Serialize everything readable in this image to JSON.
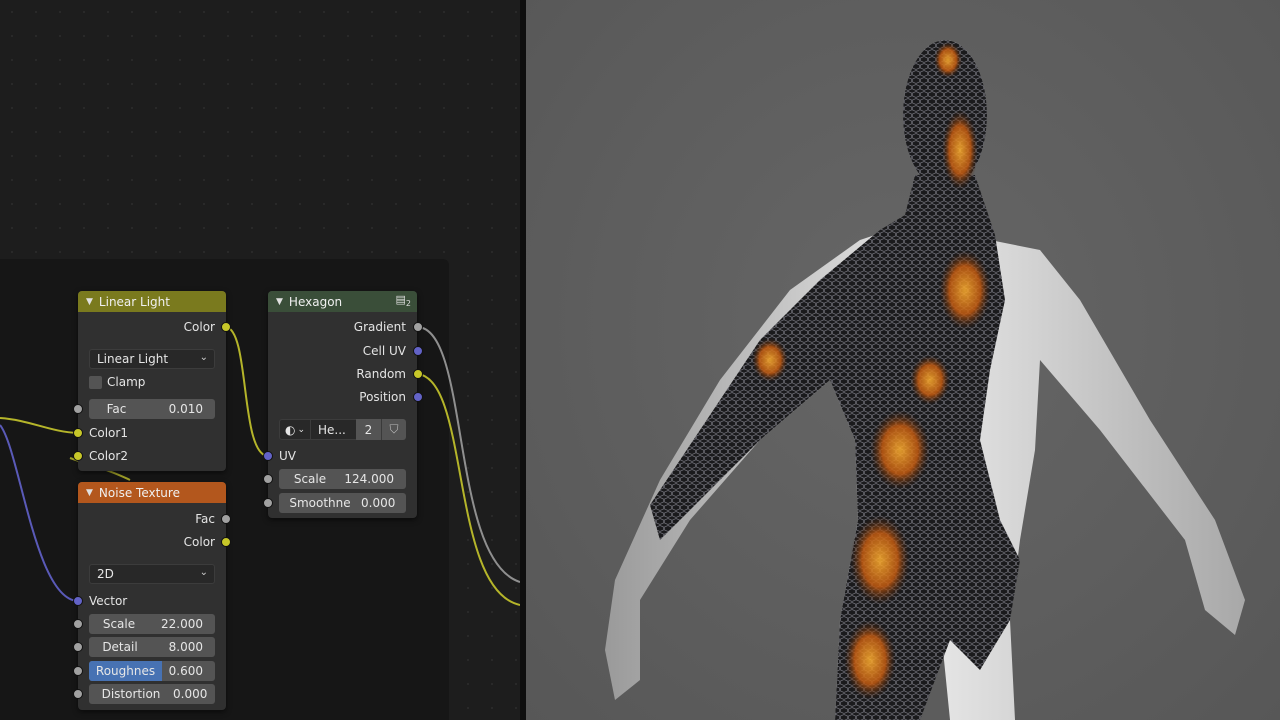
{
  "colors": {
    "wire_yellow": "#c7c729",
    "wire_grey": "#a1a1a1",
    "wire_blue": "#6363c7",
    "linear_light_header": "#7a7a1e",
    "noise_header": "#b3571d",
    "hexagon_header": "#3a4e39",
    "active_field": "#4772b3"
  },
  "linear_light": {
    "title": "Linear Light",
    "output_color": "Color",
    "blend_mode": "Linear Light",
    "clamp_label": "Clamp",
    "fac_label": "Fac",
    "fac_value": "0.010",
    "color1": "Color1",
    "color2": "Color2"
  },
  "noise_texture": {
    "title": "Noise Texture",
    "output_fac": "Fac",
    "output_color": "Color",
    "dimensions": "2D",
    "vector_label": "Vector",
    "scale_label": "Scale",
    "scale_value": "22.000",
    "detail_label": "Detail",
    "detail_value": "8.000",
    "roughness_label": "Roughnes",
    "roughness_value": "0.600",
    "distortion_label": "Distortion",
    "distortion_value": "0.000"
  },
  "hexagon": {
    "title": "Hexagon",
    "group_users": "2",
    "outputs": [
      "Gradient",
      "Cell UV",
      "Random",
      "Position"
    ],
    "datablock_name": "He...",
    "datablock_users": "2",
    "uv_label": "UV",
    "scale_label": "Scale",
    "scale_value": "124.000",
    "smoothness_label": "Smoothne",
    "smoothness_value": "0.000"
  }
}
